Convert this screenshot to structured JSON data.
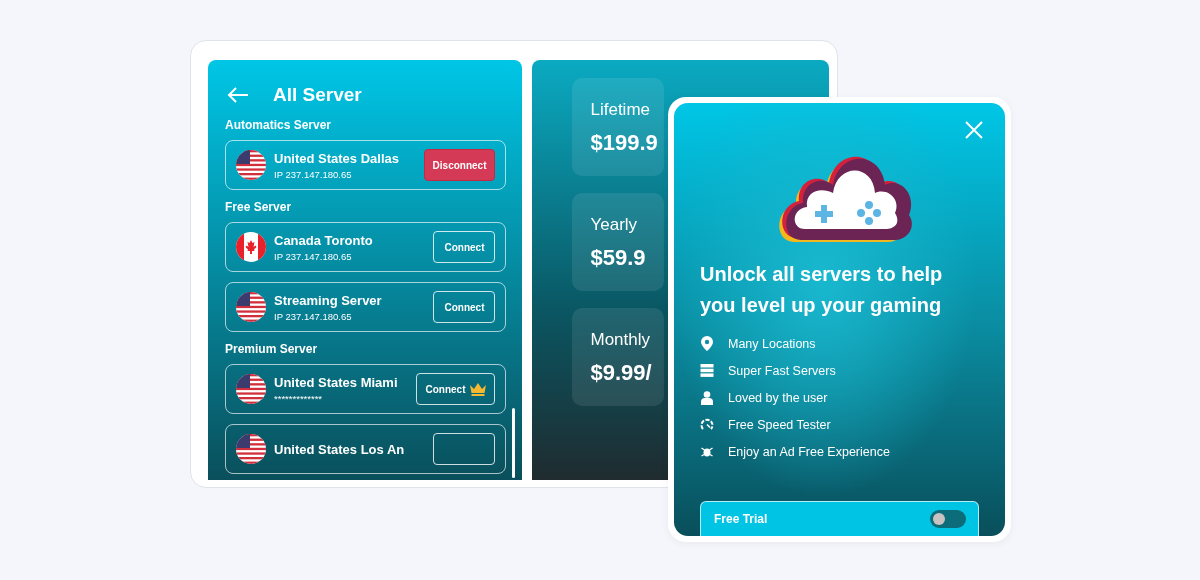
{
  "server_list": {
    "title": "All Server",
    "sections": [
      {
        "heading": "Automatics Server",
        "servers": [
          {
            "name": "United States Dallas",
            "ip": "IP 237.147.180.65",
            "kind": "us",
            "action": {
              "kind": "disconnect",
              "label": "Disconnect"
            }
          }
        ]
      },
      {
        "heading": "Free Server",
        "servers": [
          {
            "name": "Canada Toronto",
            "ip": "IP 237.147.180.65",
            "kind": "ca",
            "action": {
              "kind": "connect",
              "label": "Connect"
            }
          },
          {
            "name": "Streaming Server",
            "ip": "IP 237.147.180.65",
            "kind": "us",
            "action": {
              "kind": "connect",
              "label": "Connect"
            }
          }
        ]
      },
      {
        "heading": "Premium Server",
        "servers": [
          {
            "name": "United States Miami",
            "ip": "*************",
            "kind": "us",
            "action": {
              "kind": "premium",
              "label": "Connect"
            }
          },
          {
            "name": "United States Los An",
            "kind": "us",
            "action": {
              "kind": "connect"
            }
          }
        ]
      }
    ]
  },
  "plans": [
    {
      "name": "Lifetime",
      "price": "$199.9"
    },
    {
      "name": "Yearly",
      "price": "$59.9"
    },
    {
      "name": "Monthly",
      "price": "$9.99/"
    }
  ],
  "upgrade_dialog": {
    "headline": "Unlock all servers to help you level up your gaming",
    "features": [
      {
        "kind": "location",
        "label": "Many Locations"
      },
      {
        "kind": "servers",
        "label": "Super Fast Servers"
      },
      {
        "kind": "user",
        "label": "Loved by the user"
      },
      {
        "kind": "speed",
        "label": "Free Speed Tester"
      },
      {
        "kind": "adfree",
        "label": "Enjoy an Ad Free Experience"
      }
    ],
    "trial": {
      "label": "Free Trial",
      "on": false
    }
  }
}
